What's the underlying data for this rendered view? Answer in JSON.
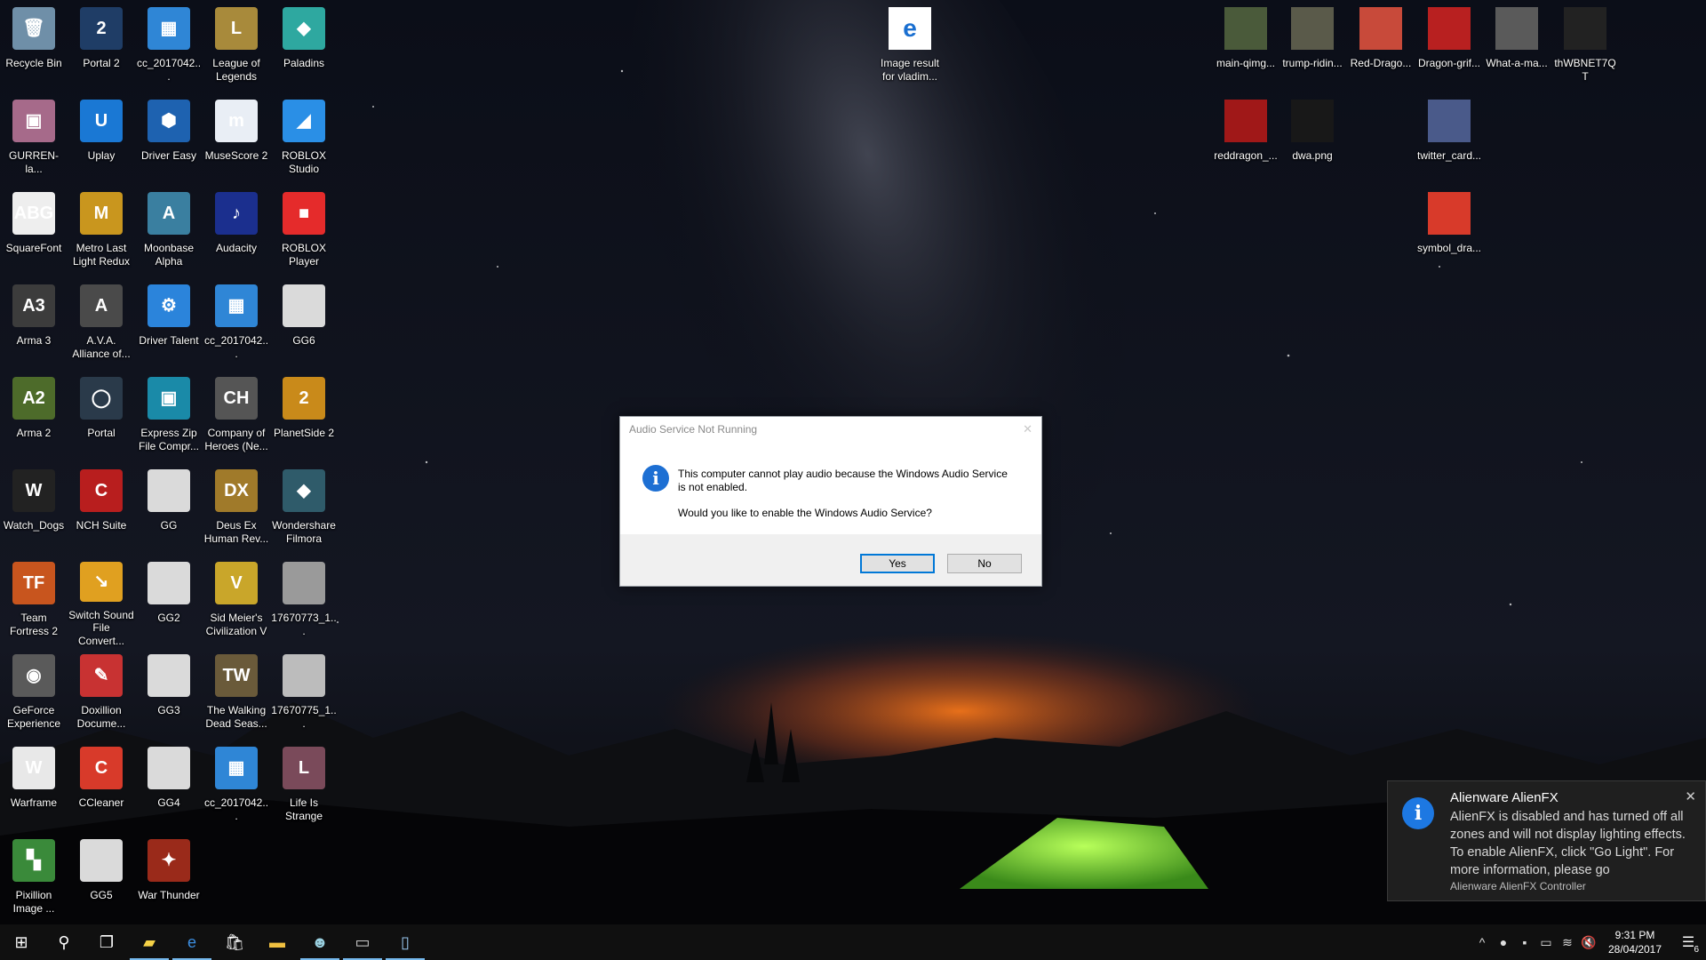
{
  "desktop": {
    "icons": [
      {
        "label": "Recycle Bin",
        "icon": "recycle-bin-icon",
        "color": "#6f8fa8",
        "glyph": "🗑"
      },
      {
        "label": "Portal 2",
        "icon": "portal-2-icon",
        "color": "#1f3d66",
        "glyph": "2"
      },
      {
        "label": "cc_2017042...",
        "icon": "archive-file-icon",
        "color": "#2f86d6",
        "glyph": "▦"
      },
      {
        "label": "League of Legends",
        "icon": "league-of-legends-icon",
        "color": "#a88a3b",
        "glyph": "L"
      },
      {
        "label": "Paladins",
        "icon": "paladins-icon",
        "color": "#2ea8a0",
        "glyph": "◆"
      },
      {
        "label": "GURREN-la...",
        "icon": "image-file-icon",
        "color": "#a66a8a",
        "glyph": "▣"
      },
      {
        "label": "Uplay",
        "icon": "uplay-icon",
        "color": "#1a78d4",
        "glyph": "U"
      },
      {
        "label": "Driver Easy",
        "icon": "driver-easy-icon",
        "color": "#1e62b0",
        "glyph": "⬢"
      },
      {
        "label": "MuseScore 2",
        "icon": "musescore-icon",
        "color": "#e9eef5",
        "glyph": "m"
      },
      {
        "label": "ROBLOX Studio",
        "icon": "roblox-studio-icon",
        "color": "#2a8fe6",
        "glyph": "◢"
      },
      {
        "label": "SquareFont",
        "icon": "squarefont-icon",
        "color": "#eeeeee",
        "glyph": "ABG"
      },
      {
        "label": "Metro Last Light Redux",
        "icon": "metro-icon",
        "color": "#c9961e",
        "glyph": "M"
      },
      {
        "label": "Moonbase Alpha",
        "icon": "moonbase-alpha-icon",
        "color": "#3a7fa0",
        "glyph": "A"
      },
      {
        "label": "Audacity",
        "icon": "audacity-icon",
        "color": "#1b2f8e",
        "glyph": "♪"
      },
      {
        "label": "ROBLOX Player",
        "icon": "roblox-player-icon",
        "color": "#e52b2b",
        "glyph": "■"
      },
      {
        "label": "Arma 3",
        "icon": "arma-3-icon",
        "color": "#3c3c3c",
        "glyph": "A3"
      },
      {
        "label": "A.V.A. Alliance of...",
        "icon": "ava-icon",
        "color": "#4a4a4a",
        "glyph": "A"
      },
      {
        "label": "Driver Talent",
        "icon": "driver-talent-icon",
        "color": "#2b84db",
        "glyph": "⚙"
      },
      {
        "label": "cc_2017042...",
        "icon": "archive-file-icon",
        "color": "#2f86d6",
        "glyph": "▦"
      },
      {
        "label": "GG6",
        "icon": "image-file-icon",
        "color": "#dadada",
        "glyph": ""
      },
      {
        "label": "Arma 2",
        "icon": "arma-2-icon",
        "color": "#4d6b2a",
        "glyph": "A2"
      },
      {
        "label": "Portal",
        "icon": "portal-icon",
        "color": "#2a3a4a",
        "glyph": "◯"
      },
      {
        "label": "Express Zip File Compr...",
        "icon": "express-zip-icon",
        "color": "#1a8aa8",
        "glyph": "▣"
      },
      {
        "label": "Company of Heroes (Ne...",
        "icon": "company-of-heroes-icon",
        "color": "#555555",
        "glyph": "CH"
      },
      {
        "label": "PlanetSide 2",
        "icon": "planetside-2-icon",
        "color": "#c98a1a",
        "glyph": "2"
      },
      {
        "label": "Watch_Dogs",
        "icon": "watch-dogs-icon",
        "color": "#222222",
        "glyph": "W"
      },
      {
        "label": "NCH Suite",
        "icon": "nch-suite-icon",
        "color": "#b81e1e",
        "glyph": "C"
      },
      {
        "label": "GG",
        "icon": "image-file-icon",
        "color": "#dadada",
        "glyph": ""
      },
      {
        "label": "Deus Ex Human Rev...",
        "icon": "deus-ex-icon",
        "color": "#a07a2a",
        "glyph": "DX"
      },
      {
        "label": "Wondershare Filmora",
        "icon": "filmora-icon",
        "color": "#2f5b6a",
        "glyph": "◆"
      },
      {
        "label": "Team Fortress 2",
        "icon": "team-fortress-2-icon",
        "color": "#c8551e",
        "glyph": "TF"
      },
      {
        "label": "Switch Sound File Convert...",
        "icon": "switch-icon",
        "color": "#e0a020",
        "glyph": "↘"
      },
      {
        "label": "GG2",
        "icon": "image-file-icon",
        "color": "#dadada",
        "glyph": ""
      },
      {
        "label": "Sid Meier's Civilization V",
        "icon": "civilization-v-icon",
        "color": "#c9a62a",
        "glyph": "V"
      },
      {
        "label": "17670773_1...",
        "icon": "image-file-icon",
        "color": "#9a9a9a",
        "glyph": ""
      },
      {
        "label": "GeForce Experience",
        "icon": "geforce-icon",
        "color": "#5a5a5a",
        "glyph": "◉"
      },
      {
        "label": "Doxillion Docume...",
        "icon": "doxillion-icon",
        "color": "#c83232",
        "glyph": "✎"
      },
      {
        "label": "GG3",
        "icon": "image-file-icon",
        "color": "#dadada",
        "glyph": ""
      },
      {
        "label": "The Walking Dead Seas...",
        "icon": "walking-dead-icon",
        "color": "#6a5a3a",
        "glyph": "TW"
      },
      {
        "label": "17670775_1...",
        "icon": "image-file-icon",
        "color": "#bcbcbc",
        "glyph": ""
      },
      {
        "label": "Warframe",
        "icon": "warframe-icon",
        "color": "#e8e8e8",
        "glyph": "W"
      },
      {
        "label": "CCleaner",
        "icon": "ccleaner-icon",
        "color": "#d83a2a",
        "glyph": "C"
      },
      {
        "label": "GG4",
        "icon": "image-file-icon",
        "color": "#dadada",
        "glyph": ""
      },
      {
        "label": "cc_2017042...",
        "icon": "archive-file-icon",
        "color": "#2f86d6",
        "glyph": "▦"
      },
      {
        "label": "Life Is Strange",
        "icon": "life-is-strange-icon",
        "color": "#7a4a5a",
        "glyph": "L"
      },
      {
        "label": "Pixillion Image ...",
        "icon": "pixillion-icon",
        "color": "#3a8a3a",
        "glyph": "▚"
      },
      {
        "label": "GG5",
        "icon": "image-file-icon",
        "color": "#dadada",
        "glyph": ""
      },
      {
        "label": "War Thunder",
        "icon": "war-thunder-icon",
        "color": "#9a2a1a",
        "glyph": "✦"
      }
    ],
    "top_icons": [
      {
        "label": "Image result for vladim...",
        "icon": "edge-shortcut-icon",
        "color": "#ffffff",
        "glyph": "e"
      },
      {
        "label": "main-qimg...",
        "icon": "image-file-icon",
        "color": "#4a5a3a",
        "glyph": ""
      },
      {
        "label": "trump-ridin...",
        "icon": "image-file-icon",
        "color": "#5a5a4a",
        "glyph": ""
      },
      {
        "label": "Red-Drago...",
        "icon": "image-file-icon",
        "color": "#c84a3a",
        "glyph": ""
      },
      {
        "label": "Dragon-grif...",
        "icon": "image-file-icon",
        "color": "#b82020",
        "glyph": ""
      },
      {
        "label": "What-a-ma...",
        "icon": "image-file-icon",
        "color": "#5a5a5a",
        "glyph": ""
      },
      {
        "label": "thWBNET7QT",
        "icon": "image-file-icon",
        "color": "#222222",
        "glyph": ""
      },
      {
        "label": "reddragon_...",
        "icon": "image-file-icon",
        "color": "#a01818",
        "glyph": ""
      },
      {
        "label": "dwa.png",
        "icon": "image-file-icon",
        "color": "#181818",
        "glyph": ""
      },
      {
        "label": "twitter_card...",
        "icon": "image-file-icon",
        "color": "#4a5a8a",
        "glyph": ""
      },
      {
        "label": "symbol_dra...",
        "icon": "image-file-icon",
        "color": "#d83a2a",
        "glyph": ""
      }
    ]
  },
  "dialog": {
    "title": "Audio Service Not Running",
    "close": "✕",
    "info_glyph": "i",
    "message": "This computer cannot play audio because the Windows Audio Service is not enabled.",
    "question": "Would you like to enable the Windows Audio Service?",
    "yes_label": "Yes",
    "no_label": "No"
  },
  "toast": {
    "title": "Alienware AlienFX",
    "message": "AlienFX is disabled and has turned off all zones and will not display lighting effects. To enable AlienFX, click \"Go Light\". For more information, please go",
    "source": "Alienware AlienFX Controller",
    "close": "✕",
    "info_glyph": "i"
  },
  "taskbar": {
    "start_glyph": "⊞",
    "search_glyph": "⚲",
    "taskview_glyph": "❐",
    "apps": [
      {
        "name": "sticky-notes-icon",
        "glyph": "▰",
        "color": "#f5d247",
        "active": true
      },
      {
        "name": "edge-icon",
        "glyph": "e",
        "color": "#3c8ee0",
        "active": true
      },
      {
        "name": "store-icon",
        "glyph": "🛍",
        "color": "#ffffff",
        "active": false
      },
      {
        "name": "file-explorer-icon",
        "glyph": "▬",
        "color": "#f0c040",
        "active": false
      },
      {
        "name": "chat-app-icon",
        "glyph": "☻",
        "color": "#9ad0e0",
        "active": true
      },
      {
        "name": "terminal-icon",
        "glyph": "▭",
        "color": "#cccccc",
        "active": true
      },
      {
        "name": "document-icon",
        "glyph": "▯",
        "color": "#9ac8f0",
        "active": true
      }
    ],
    "tray": [
      {
        "name": "show-hidden-icons-icon",
        "glyph": "^"
      },
      {
        "name": "shield-icon",
        "glyph": "●"
      },
      {
        "name": "network-device-icon",
        "glyph": "▪"
      },
      {
        "name": "battery-icon",
        "glyph": "▭"
      },
      {
        "name": "wifi-icon",
        "glyph": "≋"
      },
      {
        "name": "volume-muted-icon",
        "glyph": "🔇"
      }
    ],
    "time": "9:31 PM",
    "date": "28/04/2017",
    "notif_glyph": "☰",
    "notif_count": "6"
  }
}
